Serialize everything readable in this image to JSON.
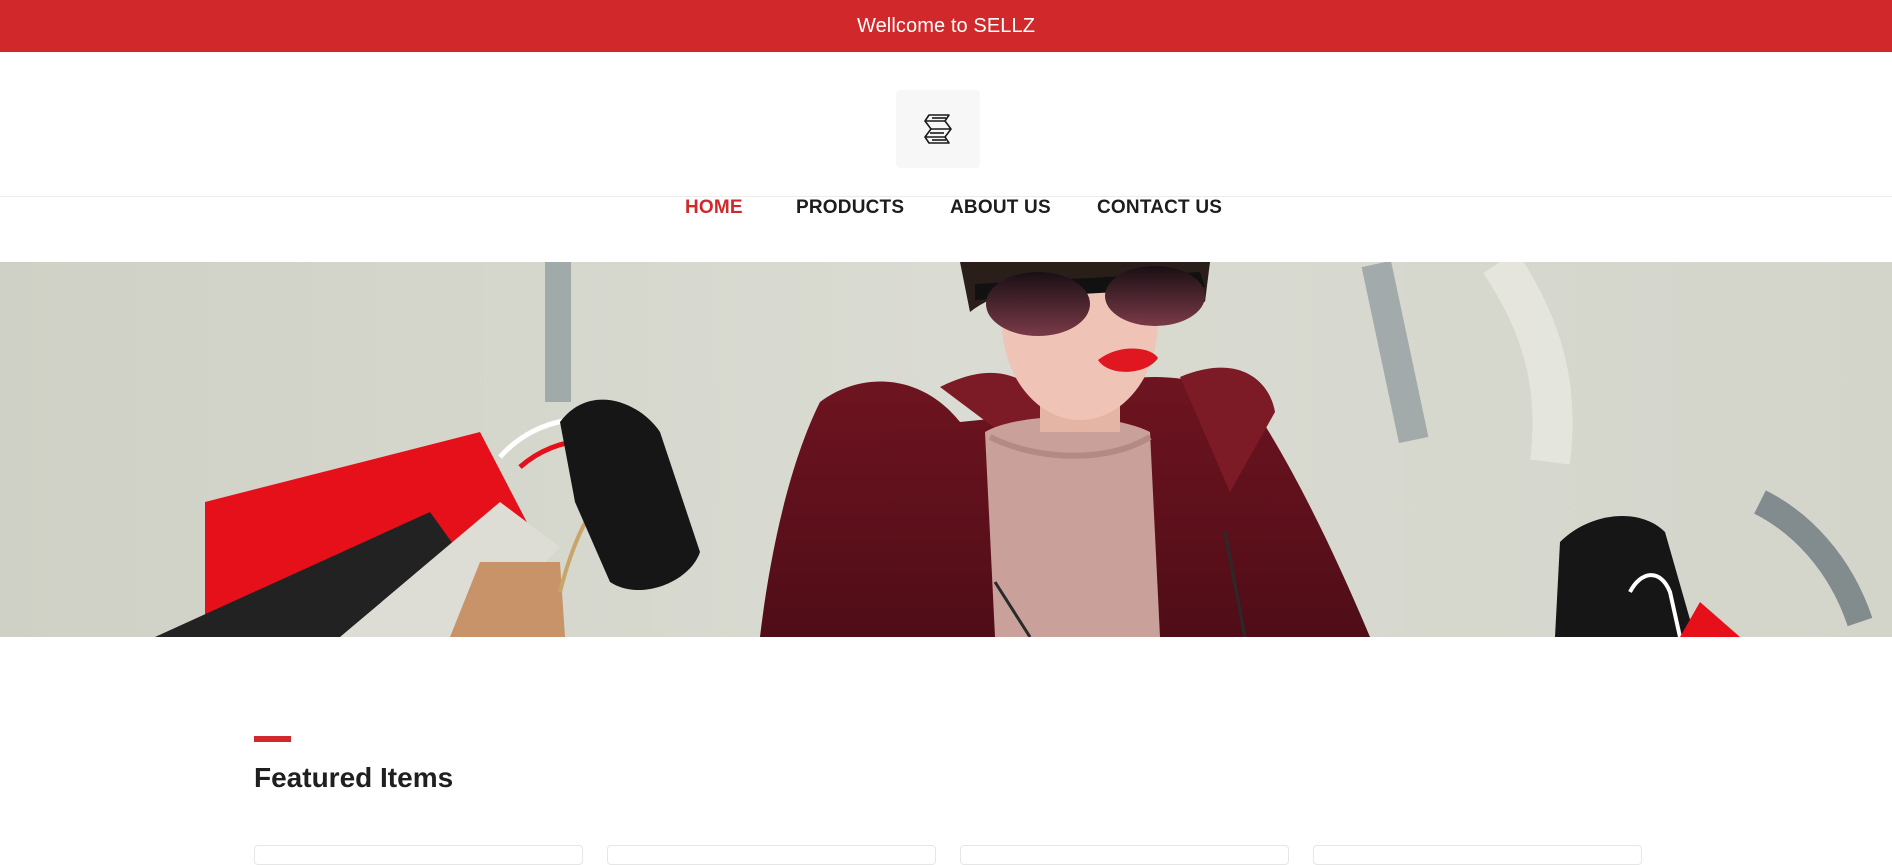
{
  "topbar": {
    "welcome_text": "Wellcome to SELLZ",
    "background_color": "#d0282b"
  },
  "brand": {
    "logo_icon": "sellz-logo-icon"
  },
  "nav": {
    "items": [
      {
        "label": "HOME",
        "active": true
      },
      {
        "label": "PRODUCTS",
        "active": false
      },
      {
        "label": "ABOUT US",
        "active": false
      },
      {
        "label": "CONTACT US",
        "active": false
      }
    ],
    "active_color": "#d0282b"
  },
  "hero": {
    "image": "banner-photo"
  },
  "featured": {
    "title": "Featured Items",
    "accent_color": "#d0282b"
  }
}
